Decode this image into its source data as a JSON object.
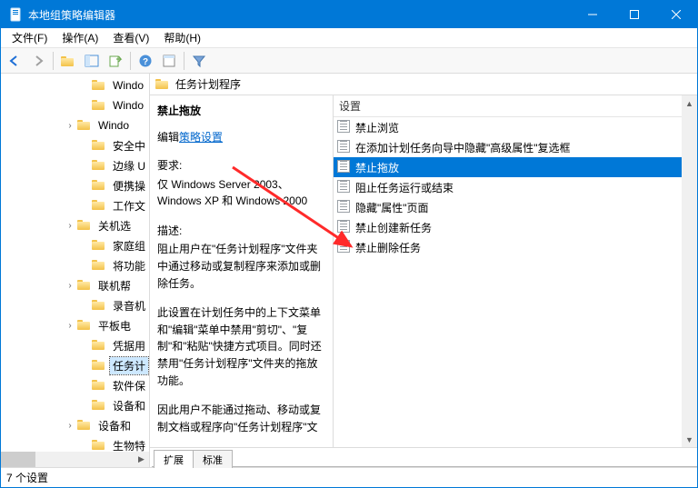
{
  "titlebar": {
    "title": "本地组策略编辑器"
  },
  "menubar": {
    "file": "文件(F)",
    "action": "操作(A)",
    "view": "查看(V)",
    "help": "帮助(H)"
  },
  "tree": {
    "items": [
      {
        "indent": 84,
        "exp": "",
        "label": "Windo"
      },
      {
        "indent": 84,
        "exp": "",
        "label": "Windo"
      },
      {
        "indent": 68,
        "exp": "›",
        "label": "Windo"
      },
      {
        "indent": 84,
        "exp": "",
        "label": "安全中"
      },
      {
        "indent": 84,
        "exp": "",
        "label": "边缘 U"
      },
      {
        "indent": 84,
        "exp": "",
        "label": "便携操"
      },
      {
        "indent": 84,
        "exp": "",
        "label": "工作文"
      },
      {
        "indent": 68,
        "exp": "›",
        "label": "关机选"
      },
      {
        "indent": 84,
        "exp": "",
        "label": "家庭组"
      },
      {
        "indent": 84,
        "exp": "",
        "label": "将功能"
      },
      {
        "indent": 68,
        "exp": "›",
        "label": "联机帮"
      },
      {
        "indent": 84,
        "exp": "",
        "label": "录音机"
      },
      {
        "indent": 68,
        "exp": "›",
        "label": "平板电"
      },
      {
        "indent": 84,
        "exp": "",
        "label": "凭据用"
      },
      {
        "indent": 84,
        "exp": "",
        "label": "任务计",
        "selected": true
      },
      {
        "indent": 84,
        "exp": "",
        "label": "软件保"
      },
      {
        "indent": 84,
        "exp": "",
        "label": "设备和"
      },
      {
        "indent": 68,
        "exp": "›",
        "label": "设备和"
      },
      {
        "indent": 84,
        "exp": "",
        "label": "生物特"
      }
    ]
  },
  "path": {
    "title": "任务计划程序"
  },
  "desc": {
    "heading": "禁止拖放",
    "edit_prefix": "编辑",
    "edit_link": "策略设置",
    "req_label": "要求:",
    "req_text": "仅 Windows Server 2003、Windows XP 和 Windows 2000",
    "desc_label": "描述:",
    "p1": "阻止用户在\"任务计划程序\"文件夹中通过移动或复制程序来添加或删除任务。",
    "p2": "此设置在计划任务中的上下文菜单和\"编辑\"菜单中禁用\"剪切\"、\"复制\"和\"粘贴\"快捷方式项目。同时还禁用\"任务计划程序\"文件夹的拖放功能。",
    "p3": "因此用户不能通过拖动、移动或复制文档或程序向\"任务计划程序\"文"
  },
  "list": {
    "header": "设置",
    "items": [
      {
        "label": "禁止浏览"
      },
      {
        "label": "在添加计划任务向导中隐藏\"高级属性\"复选框"
      },
      {
        "label": "禁止拖放",
        "selected": true
      },
      {
        "label": "阻止任务运行或结束"
      },
      {
        "label": "隐藏\"属性\"页面"
      },
      {
        "label": "禁止创建新任务"
      },
      {
        "label": "禁止删除任务"
      }
    ]
  },
  "tabs": {
    "extended": "扩展",
    "standard": "标准"
  },
  "status": {
    "text": "7 个设置"
  }
}
